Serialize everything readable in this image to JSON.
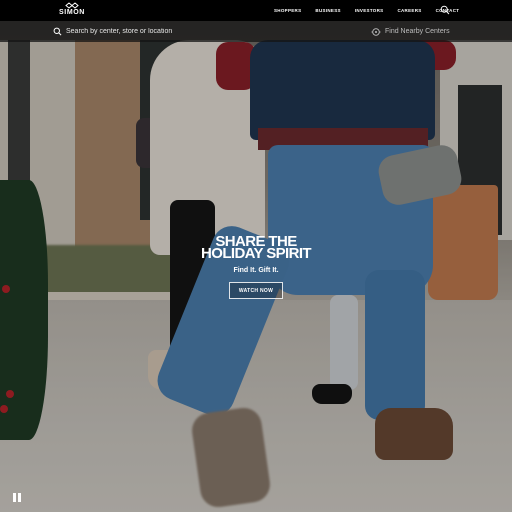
{
  "header": {
    "logo_text": "SIMON",
    "nav": [
      {
        "label": "SHOPPERS"
      },
      {
        "label": "BUSINESS"
      },
      {
        "label": "INVESTORS"
      },
      {
        "label": "CAREERS"
      },
      {
        "label": "CONTACT"
      }
    ],
    "search_icon": "search-icon"
  },
  "search": {
    "placeholder": "Search by center, store or location",
    "icon": "search-icon",
    "nearby_label": "Find Nearby Centers",
    "nearby_icon": "location-target-icon"
  },
  "hero": {
    "headline": "SHARE THE HOLIDAY SPIRIT",
    "tagline": "Find It. Gift It.",
    "cta_label": "WATCH NOW",
    "video_control_icon": "pause-icon"
  },
  "colors": {
    "topbar": "#000000",
    "text": "#ffffff",
    "nearby_text": "#bdbdbd"
  }
}
